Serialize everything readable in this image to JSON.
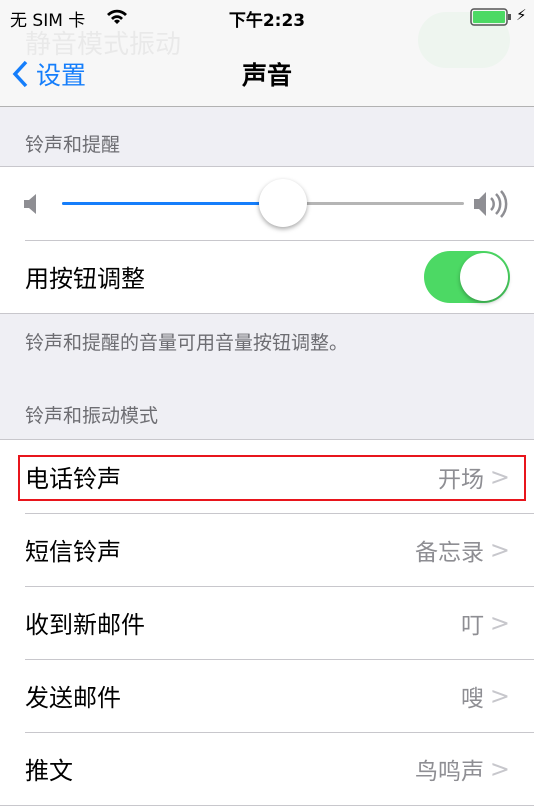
{
  "status": {
    "carrier": "无 SIM 卡",
    "time": "下午2:23",
    "battery_level": 1.0
  },
  "ghost_text": "静音模式振动",
  "nav": {
    "back_label": "设置",
    "title": "声音"
  },
  "section1": {
    "header": "铃声和提醒",
    "volume": 0.55,
    "toggle_label": "用按钮调整",
    "toggle_on": true,
    "footer": "铃声和提醒的音量可用音量按钮调整。"
  },
  "section2": {
    "header": "铃声和振动模式",
    "rows": [
      {
        "label": "电话铃声",
        "value": "开场"
      },
      {
        "label": "短信铃声",
        "value": "备忘录"
      },
      {
        "label": "收到新邮件",
        "value": "叮"
      },
      {
        "label": "发送邮件",
        "value": "嗖"
      },
      {
        "label": "推文",
        "value": "鸟鸣声"
      }
    ]
  },
  "colors": {
    "accent": "#157efb",
    "toggle": "#4cd964",
    "highlight": "#e8151c"
  }
}
